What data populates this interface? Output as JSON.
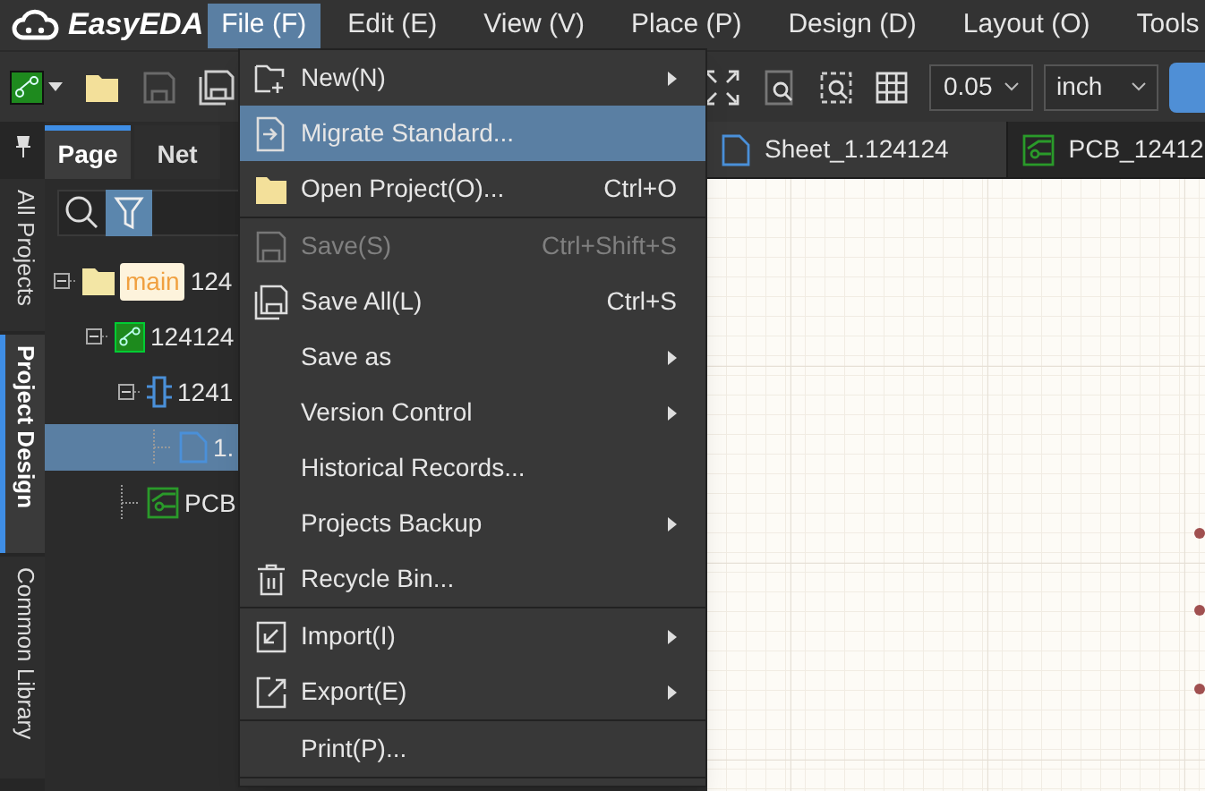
{
  "menubar": {
    "logo": "EasyEDA",
    "menus": [
      {
        "label": "File (F)",
        "selected": true
      },
      {
        "label": "Edit (E)",
        "selected": false
      },
      {
        "label": "View (V)",
        "selected": false
      },
      {
        "label": "Place (P)",
        "selected": false
      },
      {
        "label": "Design (D)",
        "selected": false
      },
      {
        "label": "Layout (O)",
        "selected": false
      },
      {
        "label": "Tools",
        "selected": false
      }
    ]
  },
  "toolbar": {
    "grid_size": "0.05",
    "unit": "inch"
  },
  "panel_tabs": [
    {
      "label": "Page",
      "selected": true
    },
    {
      "label": "Net",
      "selected": false
    }
  ],
  "side_tabs": [
    {
      "label": "All Projects",
      "selected": false
    },
    {
      "label": "Project Design",
      "selected": true
    },
    {
      "label": "Common Library",
      "selected": false
    }
  ],
  "tree": [
    {
      "kind": "folder",
      "badge": "main",
      "label": "124",
      "selected": false,
      "expanded": true,
      "children": [
        {
          "kind": "board",
          "label": "124124",
          "selected": false,
          "expanded": true,
          "children": [
            {
              "kind": "schematic",
              "label": "1241",
              "selected": false,
              "expanded": true,
              "children": [
                {
                  "kind": "sheet",
                  "label": "1.",
                  "selected": true
                }
              ]
            },
            {
              "kind": "pcb",
              "label": "PCB",
              "selected": false
            }
          ]
        }
      ]
    }
  ],
  "doc_tabs": [
    {
      "kind": "sheet",
      "label": "Sheet_1.124124",
      "selected": true
    },
    {
      "kind": "pcb",
      "label": "PCB_12412",
      "selected": false
    }
  ],
  "file_menu": [
    {
      "kind": "new",
      "label": "New(N)",
      "submenu": true,
      "selected": false,
      "disabled": false,
      "separator_after": false
    },
    {
      "kind": "migrate",
      "label": "Migrate Standard...",
      "submenu": false,
      "selected": true,
      "disabled": false,
      "separator_after": false
    },
    {
      "kind": "folder",
      "label": "Open Project(O)...",
      "shortcut": "Ctrl+O",
      "submenu": false,
      "selected": false,
      "disabled": false,
      "separator_after": true
    },
    {
      "kind": "save",
      "label": "Save(S)",
      "shortcut": "Ctrl+Shift+S",
      "submenu": false,
      "selected": false,
      "disabled": true,
      "separator_after": false
    },
    {
      "kind": "save_all",
      "label": "Save All(L)",
      "shortcut": "Ctrl+S",
      "submenu": false,
      "selected": false,
      "disabled": false,
      "separator_after": false
    },
    {
      "label": "Save as",
      "submenu": true,
      "selected": false,
      "disabled": false,
      "separator_after": false
    },
    {
      "label": "Version Control",
      "submenu": true,
      "selected": false,
      "disabled": false,
      "separator_after": false
    },
    {
      "label": "Historical Records...",
      "submenu": false,
      "selected": false,
      "disabled": false,
      "separator_after": false
    },
    {
      "label": "Projects Backup",
      "submenu": true,
      "selected": false,
      "disabled": false,
      "separator_after": false
    },
    {
      "kind": "trash",
      "label": "Recycle Bin...",
      "submenu": false,
      "selected": false,
      "disabled": false,
      "separator_after": true
    },
    {
      "kind": "import",
      "label": "Import(I)",
      "submenu": true,
      "selected": false,
      "disabled": false,
      "separator_after": false
    },
    {
      "kind": "export",
      "label": "Export(E)",
      "submenu": true,
      "selected": false,
      "disabled": false,
      "separator_after": true
    },
    {
      "label": "Print(P)...",
      "submenu": false,
      "selected": false,
      "disabled": false,
      "separator_after": true
    }
  ]
}
